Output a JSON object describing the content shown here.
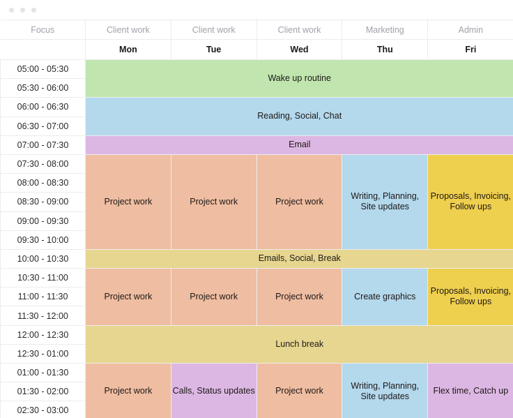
{
  "window": {
    "dots": [
      "dot-1",
      "dot-2",
      "dot-3"
    ]
  },
  "table": {
    "time_column_header": "Focus",
    "time_column_subheader": "",
    "focus_row": [
      {
        "label": "Client work"
      },
      {
        "label": "Client work"
      },
      {
        "label": "Client work"
      },
      {
        "label": "Marketing"
      },
      {
        "label": "Admin"
      }
    ],
    "days": [
      {
        "label": "Mon"
      },
      {
        "label": "Tue"
      },
      {
        "label": "Wed"
      },
      {
        "label": "Thu"
      },
      {
        "label": "Fri"
      }
    ],
    "time_slots": [
      "05:00 - 05:30",
      "05:30 - 06:00",
      "06:00 - 06:30",
      "06:30 - 07:00",
      "07:00 - 07:30",
      "07:30 - 08:00",
      "08:00 - 08:30",
      "08:30 - 09:00",
      "09:00 - 09:30",
      "09:30 - 10:00",
      "10:00 - 10:30",
      "10:30 - 11:00",
      "11:00 - 11:30",
      "11:30 - 12:00",
      "12:00 - 12:30",
      "12:30 - 01:00",
      "01:00 - 01:30",
      "01:30 - 02:00",
      "02:30 - 03:00"
    ],
    "blocks": [
      {
        "id": "wake-up-routine",
        "label": "Wake up routine",
        "color": "#c0e5ae",
        "color_name": "green",
        "start_slot": "05:00 - 05:30",
        "end_slot": "05:30 - 06:00",
        "row_span": 2,
        "col_span": 5,
        "start_day": "Mon"
      },
      {
        "id": "reading-social-chat",
        "label": "Reading, Social, Chat",
        "color": "#b4d8ec",
        "color_name": "blue",
        "start_slot": "06:00 - 06:30",
        "end_slot": "06:30 - 07:00",
        "row_span": 2,
        "col_span": 5,
        "start_day": "Mon"
      },
      {
        "id": "email",
        "label": "Email",
        "color": "#ddb7e3",
        "color_name": "purple",
        "start_slot": "07:00 - 07:30",
        "end_slot": "07:00 - 07:30",
        "row_span": 1,
        "col_span": 5,
        "start_day": "Mon"
      },
      {
        "id": "morning-mon-project",
        "label": "Project work",
        "color": "#efbda1",
        "color_name": "peach",
        "start_slot": "07:30 - 08:00",
        "end_slot": "09:30 - 10:00",
        "row_span": 5,
        "col_span": 1,
        "start_day": "Mon"
      },
      {
        "id": "morning-tue-project",
        "label": "Project work",
        "color": "#efbda1",
        "color_name": "peach",
        "start_slot": "07:30 - 08:00",
        "end_slot": "09:30 - 10:00",
        "row_span": 5,
        "col_span": 1,
        "start_day": "Tue"
      },
      {
        "id": "morning-wed-project",
        "label": "Project work",
        "color": "#efbda1",
        "color_name": "peach",
        "start_slot": "07:30 - 08:00",
        "end_slot": "09:30 - 10:00",
        "row_span": 5,
        "col_span": 1,
        "start_day": "Wed"
      },
      {
        "id": "morning-thu-writing",
        "label": "Writing, Planning, Site updates",
        "color": "#b4d8ec",
        "color_name": "blue",
        "start_slot": "07:30 - 08:00",
        "end_slot": "09:30 - 10:00",
        "row_span": 5,
        "col_span": 1,
        "start_day": "Thu"
      },
      {
        "id": "morning-fri-proposals",
        "label": "Proposals, Invoicing, Follow ups",
        "color": "#efcf4e",
        "color_name": "gold",
        "start_slot": "07:30 - 08:00",
        "end_slot": "09:30 - 10:00",
        "row_span": 5,
        "col_span": 1,
        "start_day": "Fri"
      },
      {
        "id": "emails-social-break",
        "label": "Emails, Social, Break",
        "color": "#e6d68f",
        "color_name": "khaki",
        "start_slot": "10:00 - 10:30",
        "end_slot": "10:00 - 10:30",
        "row_span": 1,
        "col_span": 5,
        "start_day": "Mon"
      },
      {
        "id": "late-morning-mon-project",
        "label": "Project work",
        "color": "#efbda1",
        "color_name": "peach",
        "start_slot": "10:30 - 11:00",
        "end_slot": "11:30 - 12:00",
        "row_span": 3,
        "col_span": 1,
        "start_day": "Mon"
      },
      {
        "id": "late-morning-tue-project",
        "label": "Project work",
        "color": "#efbda1",
        "color_name": "peach",
        "start_slot": "10:30 - 11:00",
        "end_slot": "11:30 - 12:00",
        "row_span": 3,
        "col_span": 1,
        "start_day": "Tue"
      },
      {
        "id": "late-morning-wed-project",
        "label": "Project work",
        "color": "#efbda1",
        "color_name": "peach",
        "start_slot": "10:30 - 11:00",
        "end_slot": "11:30 - 12:00",
        "row_span": 3,
        "col_span": 1,
        "start_day": "Wed"
      },
      {
        "id": "late-morning-thu-graphics",
        "label": "Create graphics",
        "color": "#b4d8ec",
        "color_name": "blue",
        "start_slot": "10:30 - 11:00",
        "end_slot": "11:30 - 12:00",
        "row_span": 3,
        "col_span": 1,
        "start_day": "Thu"
      },
      {
        "id": "late-morning-fri-proposals",
        "label": "Proposals, Invoicing, Follow ups",
        "color": "#efcf4e",
        "color_name": "gold",
        "start_slot": "10:30 - 11:00",
        "end_slot": "11:30 - 12:00",
        "row_span": 3,
        "col_span": 1,
        "start_day": "Fri"
      },
      {
        "id": "lunch-break",
        "label": "Lunch break",
        "color": "#e6d68f",
        "color_name": "khaki",
        "start_slot": "12:00 - 12:30",
        "end_slot": "12:30 - 01:00",
        "row_span": 2,
        "col_span": 5,
        "start_day": "Mon"
      },
      {
        "id": "afternoon-mon-project",
        "label": "Project work",
        "color": "#efbda1",
        "color_name": "peach",
        "start_slot": "01:00 - 01:30",
        "end_slot": "02:30 - 03:00",
        "row_span": 3,
        "col_span": 1,
        "start_day": "Mon"
      },
      {
        "id": "afternoon-tue-calls",
        "label": "Calls, Status updates",
        "color": "#ddb7e3",
        "color_name": "purple",
        "start_slot": "01:00 - 01:30",
        "end_slot": "02:30 - 03:00",
        "row_span": 3,
        "col_span": 1,
        "start_day": "Tue"
      },
      {
        "id": "afternoon-wed-project",
        "label": "Project work",
        "color": "#efbda1",
        "color_name": "peach",
        "start_slot": "01:00 - 01:30",
        "end_slot": "02:30 - 03:00",
        "row_span": 3,
        "col_span": 1,
        "start_day": "Wed"
      },
      {
        "id": "afternoon-thu-writing",
        "label": "Writing, Planning, Site updates",
        "color": "#b4d8ec",
        "color_name": "blue",
        "start_slot": "01:00 - 01:30",
        "end_slot": "02:30 - 03:00",
        "row_span": 3,
        "col_span": 1,
        "start_day": "Thu"
      },
      {
        "id": "afternoon-fri-flex",
        "label": "Flex time, Catch up",
        "color": "#ddb7e3",
        "color_name": "purple",
        "start_slot": "01:00 - 01:30",
        "end_slot": "02:30 - 03:00",
        "row_span": 3,
        "col_span": 1,
        "start_day": "Fri"
      }
    ]
  },
  "palette": {
    "green": "#c0e5ae",
    "blue": "#b4d8ec",
    "purple": "#ddb7e3",
    "peach": "#efbda1",
    "gold": "#efcf4e",
    "khaki": "#e6d68f",
    "grid_line": "#ececee",
    "header_text": "#a1a1aa",
    "body_text": "#27272a"
  }
}
